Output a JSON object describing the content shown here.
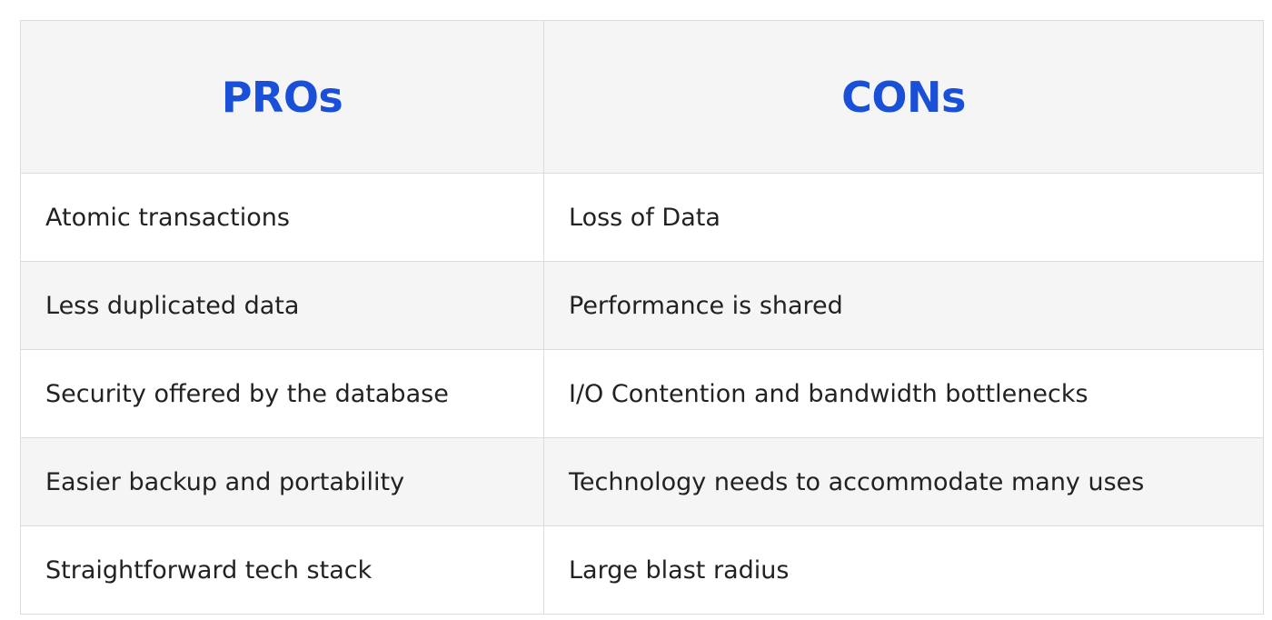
{
  "table": {
    "headers": {
      "pros": "PROs",
      "cons": "CONs"
    },
    "rows": [
      {
        "pro": "Atomic transactions",
        "con": "Loss of Data"
      },
      {
        "pro": "Less duplicated data",
        "con": "Performance is shared"
      },
      {
        "pro": "Security offered by the database",
        "con": "I/O Contention and bandwidth bottlenecks"
      },
      {
        "pro": "Easier backup and portability",
        "con": "Technology needs to accommodate many uses"
      },
      {
        "pro": "Straightforward tech stack",
        "con": "Large blast radius"
      }
    ]
  },
  "colors": {
    "header_text": "#1a4fd8",
    "header_bg": "#f5f5f5",
    "border": "#dcdcdc",
    "body_text": "#222222"
  }
}
